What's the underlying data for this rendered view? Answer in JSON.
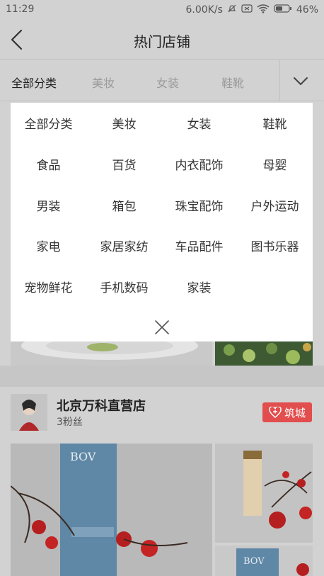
{
  "status_bar": {
    "time": "11:29",
    "net_speed": "6.00K/s",
    "battery": "46%"
  },
  "header": {
    "title": "热门店铺",
    "back_icon": "back-arrow-icon"
  },
  "tabs": {
    "items": [
      "全部分类",
      "美妆",
      "女装",
      "鞋靴"
    ],
    "active": "全部分类",
    "expand_icon": "chevron-down-icon"
  },
  "categories": [
    [
      "全部分类",
      "美妆",
      "女装",
      "鞋靴"
    ],
    [
      "食品",
      "百货",
      "内衣配饰",
      "母婴"
    ],
    [
      "男装",
      "箱包",
      "珠宝配饰",
      "户外运动"
    ],
    [
      "家电",
      "家居家纺",
      "车品配件",
      "图书乐器"
    ],
    [
      "宠物鲜花",
      "手机数码",
      "家装"
    ]
  ],
  "store": {
    "name": "北京万科直营店",
    "fans": "3粉丝",
    "follow_label": "筑城",
    "product_brand": "BOV"
  },
  "colors": {
    "accent": "#e24d4d",
    "overlay_bg": "#d2d2d2",
    "panel_bg": "#ffffff"
  }
}
